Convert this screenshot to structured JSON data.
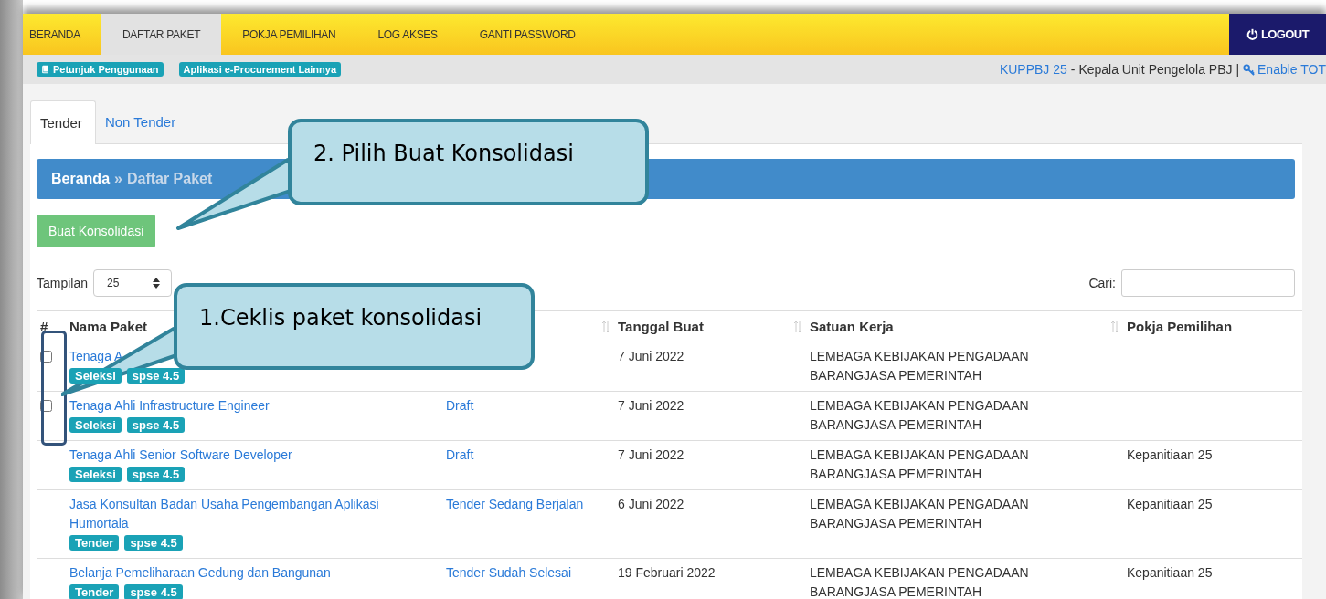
{
  "nav": {
    "items": [
      {
        "label": "BERANDA",
        "selected": false
      },
      {
        "label": "DAFTAR PAKET",
        "selected": true
      },
      {
        "label": "POKJA PEMILIHAN",
        "selected": false
      },
      {
        "label": "LOG AKSES",
        "selected": false
      },
      {
        "label": "GANTI PASSWORD",
        "selected": false
      }
    ],
    "logout": "LOGOUT"
  },
  "subbar": {
    "buttons": [
      {
        "label": "Petunjuk Penggunaan",
        "kind": "book"
      },
      {
        "label": "Aplikasi e-Procurement Lainnya",
        "kind": "plain"
      }
    ],
    "user_link": "KUPPBJ 25",
    "user_role": "- Kepala Unit Pengelola PBJ |",
    "totp": "Enable TOT"
  },
  "tabs": [
    {
      "label": "Tender",
      "selected": true
    },
    {
      "label": "Non Tender",
      "selected": false
    }
  ],
  "breadcrumb": {
    "home": "Beranda",
    "separator": "»",
    "current": "Daftar Paket"
  },
  "create_button": "Buat Konsolidasi",
  "length": {
    "label": "Tampilan",
    "value": "25"
  },
  "search": {
    "label": "Cari:"
  },
  "table": {
    "columns": [
      {
        "label": "#",
        "sortable": false
      },
      {
        "label": "Nama Paket"
      },
      {
        "sortable": true
      },
      {
        "label": "Tanggal Buat",
        "sortable": true
      },
      {
        "label": "Satuan Kerja",
        "sortable": true
      },
      {
        "label": "Pokja Pemilihan",
        "sortable": false
      }
    ],
    "rows": [
      {
        "checkbox": {
          "checked": false
        },
        "name": "Tenaga A",
        "badges": [
          "Seleksi",
          "spse 4.5"
        ],
        "date": "7 Juni 2022",
        "unit": "LEMBAGA KEBIJAKAN PENGADAAN BARANGJASA PEMERINTAH"
      },
      {
        "checkbox": {
          "checked": false
        },
        "name": "Tenaga Ahli Infrastructure Engineer",
        "badges": [
          "Seleksi",
          "spse 4.5"
        ],
        "status": "Draft",
        "date": "7 Juni 2022",
        "unit": "LEMBAGA KEBIJAKAN PENGADAAN BARANGJASA PEMERINTAH"
      },
      {
        "name": "Tenaga Ahli Senior Software Developer",
        "badges": [
          "Seleksi",
          "spse 4.5"
        ],
        "status": "Draft",
        "date": "7 Juni 2022",
        "unit": "LEMBAGA KEBIJAKAN PENGADAAN BARANGJASA PEMERINTAH",
        "pokja": "Kepanitiaan 25"
      },
      {
        "name": "Jasa Konsultan Badan Usaha Pengembangan Aplikasi Humortala",
        "badges": [
          "Tender",
          "spse 4.5"
        ],
        "status": "Tender Sedang Berjalan",
        "date": "6 Juni 2022",
        "unit": "LEMBAGA KEBIJAKAN PENGADAAN BARANGJASA PEMERINTAH",
        "pokja": "Kepanitiaan 25"
      },
      {
        "name": "Belanja Pemeliharaan Gedung dan Bangunan",
        "badges": [
          "Tender",
          "spse 4.5"
        ],
        "status": "Tender Sudah Selesai",
        "date": "19 Februari 2022",
        "unit": "LEMBAGA KEBIJAKAN PENGADAAN BARANGJASA PEMERINTAH",
        "pokja": "Kepanitiaan 25"
      }
    ]
  },
  "annotations": [
    {
      "text": "2. Pilih Buat Konsolidasi",
      "kind": "callout-button"
    },
    {
      "text": "1.Ceklis paket konsolidasi",
      "kind": "callout-checkbox"
    }
  ]
}
